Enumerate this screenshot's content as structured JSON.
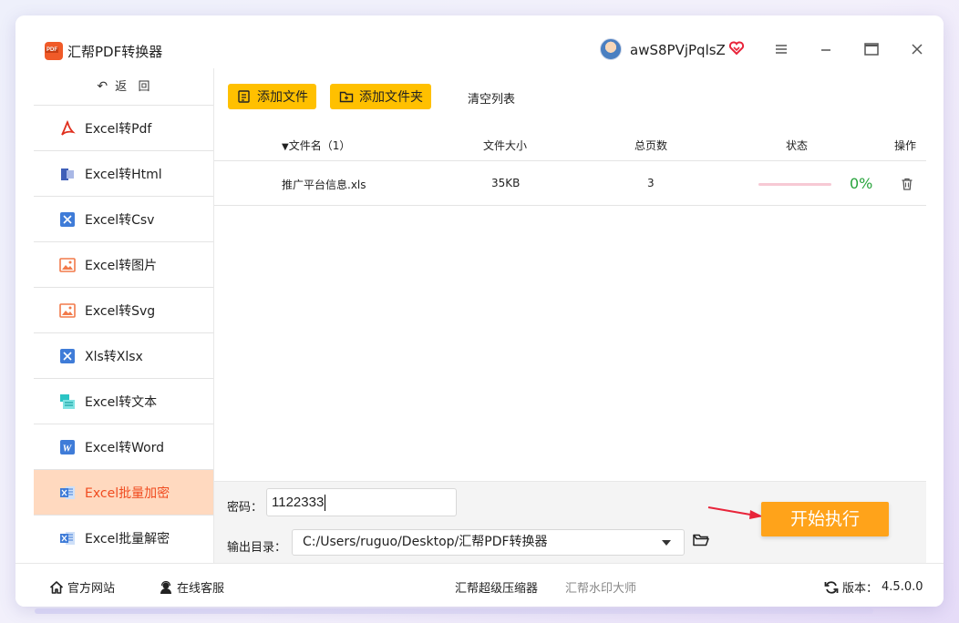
{
  "app": {
    "title": "汇帮PDF转换器",
    "username": "awS8PVjPqlsZ"
  },
  "sidebar": {
    "back_label": "返   回",
    "items": [
      {
        "label": "Excel转Pdf",
        "icon": "pdf-icon"
      },
      {
        "label": "Excel转Html",
        "icon": "html-icon"
      },
      {
        "label": "Excel转Csv",
        "icon": "excel-icon"
      },
      {
        "label": "Excel转图片",
        "icon": "image-icon"
      },
      {
        "label": "Excel转Svg",
        "icon": "image-icon"
      },
      {
        "label": "Xls转Xlsx",
        "icon": "excel-icon"
      },
      {
        "label": "Excel转文本",
        "icon": "text-icon"
      },
      {
        "label": "Excel转Word",
        "icon": "word-icon"
      },
      {
        "label": "Excel批量加密",
        "icon": "excel-batch-icon",
        "active": true
      },
      {
        "label": "Excel批量解密",
        "icon": "excel-batch-icon"
      }
    ]
  },
  "toolbar": {
    "add_file": "添加文件",
    "add_folder": "添加文件夹",
    "clear_list": "清空列表"
  },
  "table": {
    "headers": {
      "filename": "文件名（1）",
      "size": "文件大小",
      "pages": "总页数",
      "status": "状态",
      "action": "操作"
    },
    "rows": [
      {
        "filename": "推广平台信息.xls",
        "size": "35KB",
        "pages": "3",
        "progress": 0,
        "progress_label": "0%"
      }
    ]
  },
  "settings": {
    "password_label": "密码：",
    "password_value": "1122333",
    "output_label": "输出目录：",
    "output_path": "C:/Users/ruguo/Desktop/汇帮PDF转换器",
    "start_button": "开始执行"
  },
  "footer": {
    "website": "官方网站",
    "support": "在线客服",
    "product1": "汇帮超级压缩器",
    "product2": "汇帮水印大师",
    "version_label": "版本：",
    "version": "4.5.0.0"
  },
  "colors": {
    "accent": "#ffc000",
    "start": "#ffa31a",
    "active_bg": "#ffd9bf",
    "active_text": "#f04b1f",
    "progress": "#27a33b"
  }
}
